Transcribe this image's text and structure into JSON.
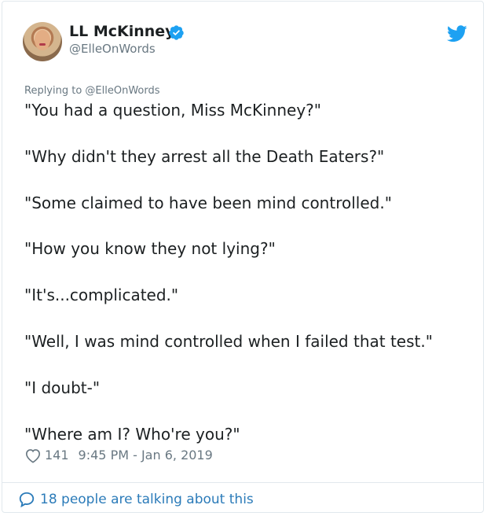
{
  "author": {
    "display_name": "LL McKinney",
    "handle": "@ElleOnWords",
    "verified": true,
    "avatar_icon": "profile-photo"
  },
  "platform_icon": "twitter-bird-icon",
  "reply": {
    "text": "Replying to @ElleOnWords"
  },
  "tweet": {
    "lines": [
      "\"You had a question, Miss McKinney?\"",
      "\"Why didn't they arrest all the Death Eaters?\"",
      "\"Some claimed to have been mind controlled.\"",
      "\"How you know they not lying?\"",
      "\"It's...complicated.\"",
      "\"Well, I was mind controlled when I failed that test.\"",
      "\"I doubt-\"",
      "\"Where am I? Who're you?\""
    ]
  },
  "meta": {
    "likes": "141",
    "timestamp": "9:45 PM - Jan 6, 2019"
  },
  "footer": {
    "talking_text": "18 people are talking about this"
  },
  "colors": {
    "accent": "#1da1f2",
    "link": "#2b7bb9",
    "muted": "#697882",
    "text": "#1c2022",
    "border": "#e1e8ed"
  }
}
